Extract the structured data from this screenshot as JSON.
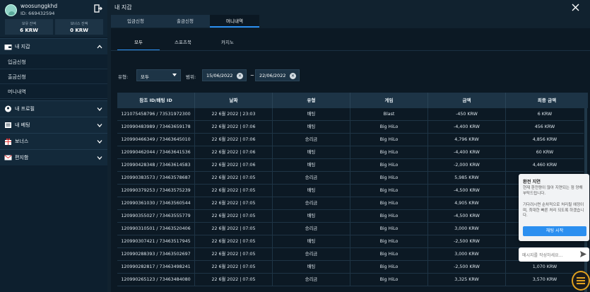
{
  "user": {
    "name": "woosunggkhd",
    "id_text": "ID: 669432594"
  },
  "balances": [
    {
      "label": "보유 잔액",
      "value": "6 KRW"
    },
    {
      "label": "보너스 잔액",
      "value": "0 KRW"
    }
  ],
  "sidebar": {
    "wallet_label": "내 지갑",
    "wallet_items": [
      "입금신청",
      "출금신청",
      "머니내역"
    ],
    "sections": [
      "내 프로필",
      "내 베팅",
      "보너스",
      "편지함"
    ]
  },
  "main": {
    "title": "내 지갑",
    "tabs": [
      "입금신청",
      "출금신청",
      "머니내역"
    ],
    "subtabs": [
      "모두",
      "스포츠북",
      "카지노"
    ],
    "filter": {
      "type_label": "유형:",
      "type_value": "모두",
      "range_label": "범위:",
      "date_from": "15/06/2022",
      "date_to": "22/06/2022",
      "separator": "~"
    }
  },
  "table": {
    "headers": [
      "참조 ID/배팅 ID",
      "날짜",
      "유형",
      "게임",
      "금액",
      "최종 금액"
    ],
    "rows": [
      [
        "121075458796 / 73531972300",
        "22 6월 2022 | 23:03",
        "배팅",
        "Blast",
        "-450 KRW",
        "6 KRW"
      ],
      [
        "120990483989 / 73463659178",
        "22 6월 2022 | 07:06",
        "배팅",
        "Big HiLo",
        "-4,400 KRW",
        "456 KRW"
      ],
      [
        "120990466349 / 73463645010",
        "22 6월 2022 | 07:06",
        "승리금",
        "Big HiLo",
        "4,796 KRW",
        "4,856 KRW"
      ],
      [
        "120990462044 / 73463641536",
        "22 6월 2022 | 07:06",
        "배팅",
        "Big HiLo",
        "-4,400 KRW",
        "60 KRW"
      ],
      [
        "120990428348 / 73463614583",
        "22 6월 2022 | 07:06",
        "배팅",
        "Big HiLo",
        "-2,000 KRW",
        "4,460 KRW"
      ],
      [
        "120990383573 / 73463578687",
        "22 6월 2022 | 07:05",
        "승리금",
        "Big HiLo",
        "5,985 KRW",
        ""
      ],
      [
        "120990379253 / 73463575239",
        "22 6월 2022 | 07:05",
        "배팅",
        "Big HiLo",
        "-4,500 KRW",
        ""
      ],
      [
        "120990361030 / 73463560544",
        "22 6월 2022 | 07:05",
        "승리금",
        "Big HiLo",
        "4,905 KRW",
        ""
      ],
      [
        "120990355027 / 73463555779",
        "22 6월 2022 | 07:05",
        "배팅",
        "Big HiLo",
        "-4,500 KRW",
        ""
      ],
      [
        "120990310501 / 73463520406",
        "22 6월 2022 | 07:05",
        "승리금",
        "Big HiLo",
        "3,000 KRW",
        ""
      ],
      [
        "120990307421 / 73463517945",
        "22 6월 2022 | 07:05",
        "배팅",
        "Big HiLo",
        "-2,500 KRW",
        ""
      ],
      [
        "120990288393 / 73463502697",
        "22 6월 2022 | 07:05",
        "승리금",
        "Big HiLo",
        "3,000 KRW",
        ""
      ],
      [
        "120990282817 / 73463498241",
        "22 6월 2022 | 07:05",
        "배팅",
        "Big HiLo",
        "-2,500 KRW",
        "1,070 KRW"
      ],
      [
        "120990265123 / 73463484080",
        "22 6월 2022 | 07:05",
        "승리금",
        "Big HiLo",
        "3,325 KRW",
        "3,570 KRW"
      ]
    ]
  },
  "chat": {
    "header": "환전 지연",
    "message1": "현재 환전량이 많아 지연되는 점 양해 부탁드립니다.",
    "message2": "기다려시면 순차적으로 처리될 예정이며, 최대한 빠른 처리 되도록 하겠습니다.",
    "start_button": "채팅 시작",
    "input_placeholder": "메시지를 작성하세요..."
  },
  "colors": {
    "accent": "#2b8ff0",
    "sidebar_bg": "#0d1f2e",
    "panel_bg": "#0c1924"
  }
}
